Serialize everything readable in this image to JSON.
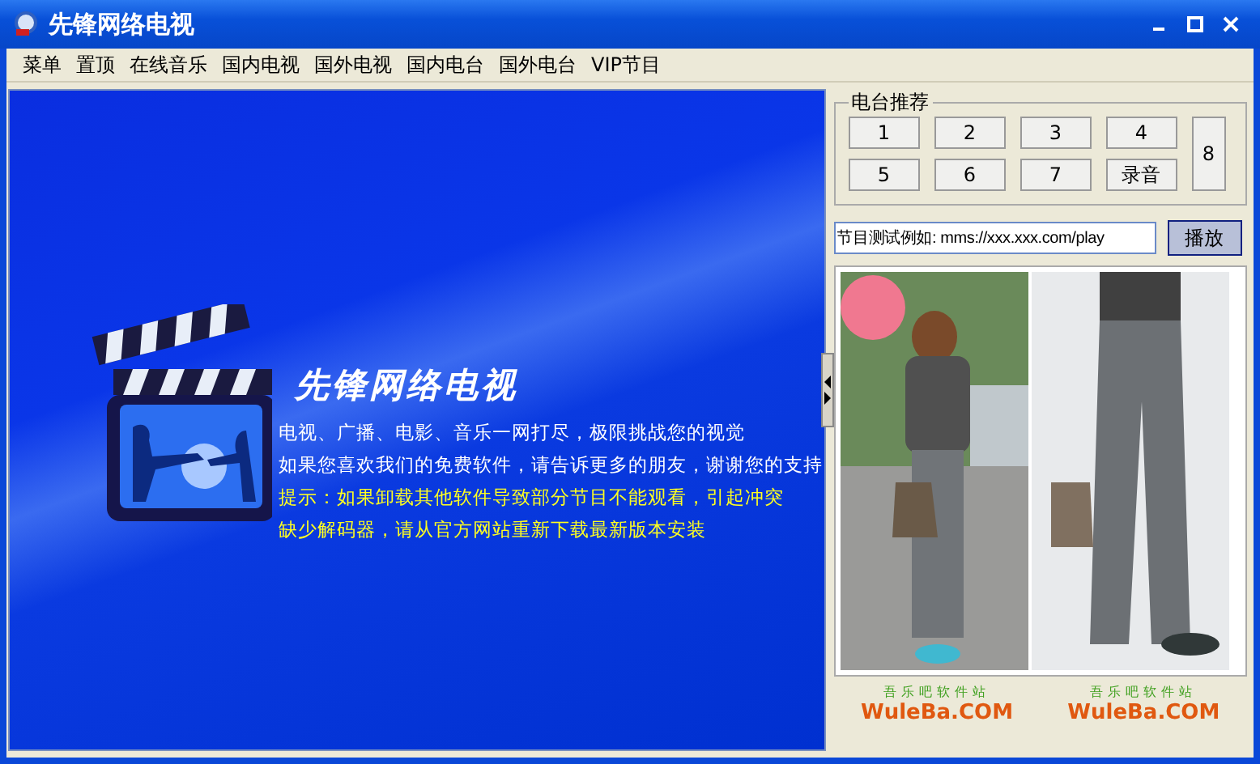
{
  "window": {
    "title": "先锋网络电视"
  },
  "menu": [
    "菜单",
    "置顶",
    "在线音乐",
    "国内电视",
    "国外电视",
    "国内电台",
    "国外电台",
    "VIP节目"
  ],
  "splash": {
    "title": "先锋网络电视",
    "lines": [
      {
        "text": "电视、广播、电影、音乐一网打尽，极限挑战您的视觉",
        "kind": "info"
      },
      {
        "text": "如果您喜欢我们的免费软件，请告诉更多的朋友，谢谢您的支持",
        "kind": "info"
      },
      {
        "text": "提示：如果卸载其他软件导致部分节目不能观看，引起冲突",
        "kind": "tip"
      },
      {
        "text": "缺少解码器，请从官方网站重新下载最新版本安装",
        "kind": "tip"
      }
    ]
  },
  "stations": {
    "title": "电台推荐",
    "buttons": [
      {
        "label": "1",
        "kind": "normal"
      },
      {
        "label": "2",
        "kind": "normal"
      },
      {
        "label": "3",
        "kind": "normal"
      },
      {
        "label": "4",
        "kind": "normal"
      },
      {
        "label": "8",
        "kind": "tall"
      },
      {
        "label": "5",
        "kind": "normal"
      },
      {
        "label": "6",
        "kind": "normal"
      },
      {
        "label": "7",
        "kind": "normal"
      },
      {
        "label": "录音",
        "kind": "normal"
      }
    ]
  },
  "url_field": {
    "value": "节目测试例如: mms://xxx.xxx.com/play"
  },
  "play_button": "播放",
  "ad": {
    "kind": "picture"
  },
  "logos": [
    {
      "tagline": "吾乐吧软件站",
      "name": "WuleBa.COM"
    },
    {
      "tagline": "吾乐吧软件站",
      "name": "WuleBa.COM"
    }
  ]
}
